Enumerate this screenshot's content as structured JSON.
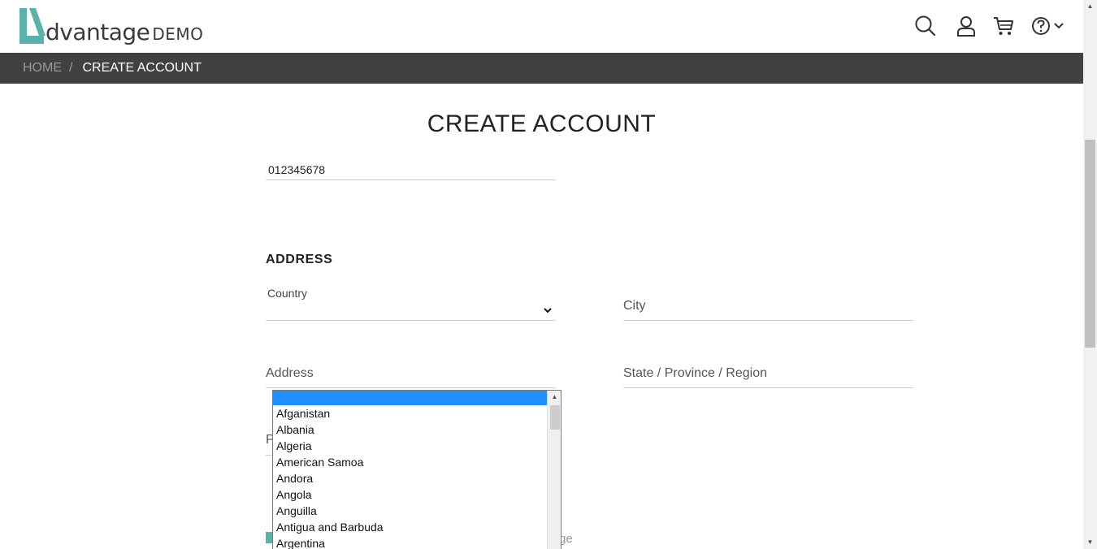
{
  "header": {
    "logo_word": "dvantage",
    "logo_demo": "DEMO",
    "icons": [
      "search-icon",
      "user-icon",
      "cart-icon",
      "help-icon",
      "chevron-down-icon"
    ]
  },
  "breadcrumb": {
    "home": "HOME",
    "separator": "/",
    "current": "CREATE ACCOUNT"
  },
  "page": {
    "title": "CREATE ACCOUNT",
    "phone_value": "012345678",
    "address_section": "ADDRESS",
    "country_label": "Country",
    "city_label": "City",
    "address_label": "Address",
    "state_label": "State / Province / Region",
    "partial_label": "P",
    "partial_text": "ge"
  },
  "country_dropdown": {
    "selected_index": 0,
    "options": [
      "",
      "Afganistan",
      "Albania",
      "Algeria",
      "American Samoa",
      "Andora",
      "Angola",
      "Anguilla",
      "Antigua and Barbuda",
      "Argentina"
    ]
  },
  "colors": {
    "accent": "#5bb2a8",
    "breadcrumb_bg": "#414141",
    "selection": "#1e90ff"
  }
}
